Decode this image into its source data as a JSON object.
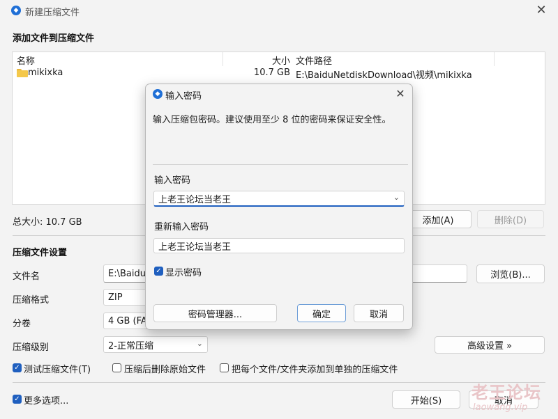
{
  "window": {
    "title": "新建压缩文件",
    "close_glyph": "✕"
  },
  "files_section": {
    "title": "添加文件到压缩文件",
    "columns": {
      "name": "名称",
      "size": "大小",
      "path": "文件路径"
    },
    "rows": [
      {
        "name": "mikixka",
        "size": "10.7 GB",
        "path": "E:\\BaiduNetdiskDownload\\视频\\mikixka",
        "icon": "folder-icon"
      }
    ],
    "total_label": "总大小: 10.7 GB",
    "add_button": "添加(A)",
    "delete_button": "删除(D)"
  },
  "settings": {
    "title": "压缩文件设置",
    "filename_label": "文件名",
    "filename_value": "E:\\BaiduN",
    "browse_button": "浏览(B)...",
    "format_label": "压缩格式",
    "format_value": "ZIP",
    "split_label": "分卷",
    "split_value": "4 GB (FAT",
    "level_label": "压缩级别",
    "level_value": "2-正常压缩",
    "advanced_button": "高级设置 »",
    "test_archive": {
      "label": "测试压缩文件(T)",
      "checked": true
    },
    "delete_after": {
      "label": "压缩后删除原始文件",
      "checked": false
    },
    "each_separate": {
      "label": "把每个文件/文件夹添加到单独的压缩文件",
      "checked": false
    }
  },
  "footer": {
    "more_options": {
      "label": "更多选项...",
      "checked": true
    },
    "start_button": "开始(S)",
    "cancel_button": "取消"
  },
  "dialog": {
    "title": "输入密码",
    "close_glyph": "✕",
    "description": "输入压缩包密码。建议使用至少 8 位的密码来保证安全性。",
    "password_label": "输入密码",
    "password_value": "上老王论坛当老王",
    "reenter_label": "重新输入密码",
    "reenter_value": "上老王论坛当老王",
    "show_password": {
      "label": "显示密码",
      "checked": true
    },
    "manager_button": "密码管理器...",
    "ok_button": "确定",
    "cancel_button": "取消"
  },
  "watermark": {
    "line1": "老王论坛",
    "line2": "laowang.vip"
  },
  "colors": {
    "accent": "#1f5fbf",
    "app_icon": "#1f6fd6",
    "watermark": "#e9c5c8"
  }
}
